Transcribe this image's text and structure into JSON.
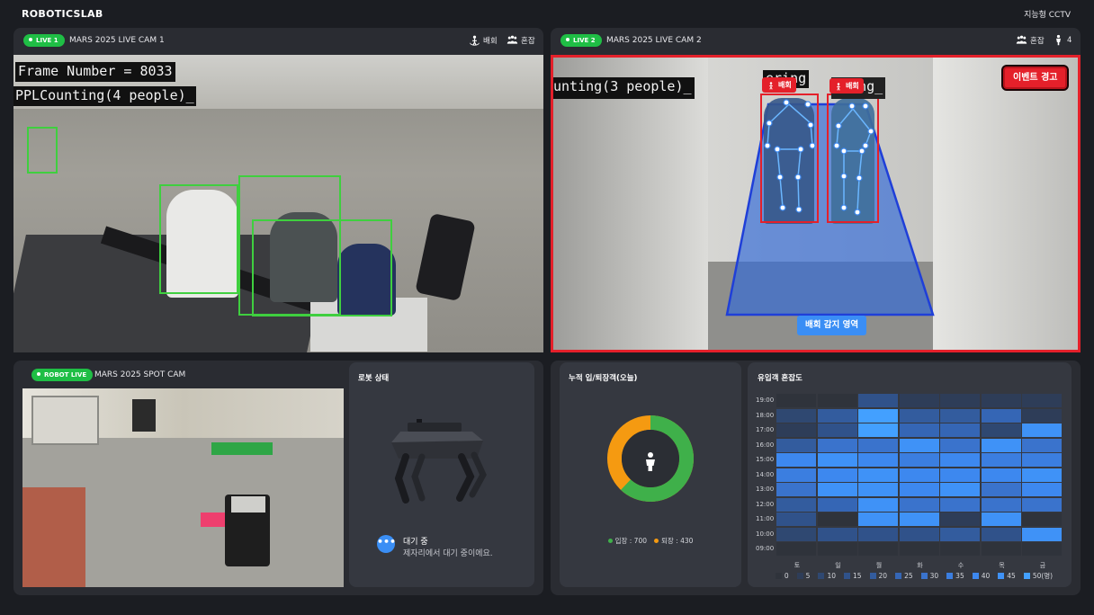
{
  "brand": "ROBOTICSLAB",
  "app_title": "지능형 CCTV",
  "cam1": {
    "badge": "LIVE 1",
    "title": "MARS 2025 LIVE CAM 1",
    "tags": [
      {
        "icon": "loitering-icon",
        "label": "배회"
      },
      {
        "icon": "crowd-icon",
        "label": "혼잡"
      }
    ],
    "osd_line1": "Frame Number =  8033",
    "osd_line2": "PPLCounting(4 people)_"
  },
  "cam2": {
    "badge": "LIVE 2",
    "title": "MARS 2025 LIVE CAM 2",
    "tag_crowd": "혼잡",
    "person_count": "4",
    "osd_line1": "unting(3 people)_",
    "osd_ering1": "ering",
    "osd_ering2": "ering_",
    "event_alert": "이벤트 경고",
    "person_tag": "배회",
    "zone_label": "배회 감지 영역"
  },
  "spot": {
    "badge": "ROBOT LIVE",
    "title": "MARS 2025 SPOT CAM"
  },
  "robot_status": {
    "title": "로봇 상태",
    "state": "대기 중",
    "state_detail": "제자리에서 대기 중이에요."
  },
  "visitors": {
    "title": "누적 입/퇴장객(오늘)",
    "in_label": "입장",
    "in_value": 700,
    "in_text": "입장 : 700",
    "out_label": "퇴장",
    "out_value": 430,
    "out_text": "퇴장 : 430",
    "in_color": "#3fb04a",
    "out_color": "#f59a11"
  },
  "heatmap": {
    "title": "유입객 혼잡도",
    "hours": [
      "19:00",
      "18:00",
      "17:00",
      "16:00",
      "15:00",
      "14:00",
      "13:00",
      "12:00",
      "11:00",
      "10:00",
      "09:00"
    ],
    "days": [
      "토",
      "일",
      "월",
      "화",
      "수",
      "목",
      "금"
    ],
    "levels": [
      [
        0,
        0,
        3,
        1,
        1,
        1,
        1
      ],
      [
        2,
        4,
        10,
        4,
        4,
        5,
        1
      ],
      [
        1,
        3,
        10,
        5,
        5,
        2,
        9
      ],
      [
        4,
        6,
        6,
        9,
        6,
        9,
        6
      ],
      [
        8,
        9,
        8,
        7,
        8,
        7,
        7
      ],
      [
        7,
        8,
        9,
        8,
        8,
        8,
        9
      ],
      [
        6,
        9,
        9,
        8,
        9,
        6,
        8
      ],
      [
        4,
        5,
        9,
        6,
        6,
        6,
        6
      ],
      [
        3,
        0,
        9,
        9,
        1,
        9,
        0
      ],
      [
        2,
        3,
        3,
        3,
        4,
        3,
        9
      ],
      [
        0,
        0,
        0,
        0,
        0,
        0,
        0
      ]
    ],
    "legend": [
      "0",
      "5",
      "10",
      "15",
      "20",
      "25",
      "30",
      "35",
      "40",
      "45",
      "50(명)"
    ],
    "colors": [
      "#2f333b",
      "#2e3d58",
      "#2f4871",
      "#30528a",
      "#335c9e",
      "#3566b5",
      "#3a73cc",
      "#3b7ee0",
      "#3d88ef",
      "#3f92f7",
      "#43a0ff"
    ]
  }
}
